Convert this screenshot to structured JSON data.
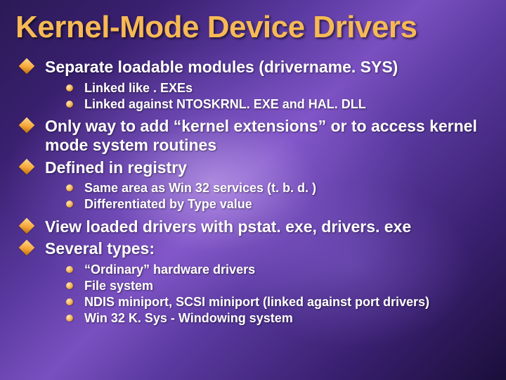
{
  "title": "Kernel-Mode Device Drivers",
  "points": [
    {
      "text": "Separate loadable modules (drivername. SYS)",
      "sub": [
        "Linked like . EXEs",
        "Linked against NTOSKRNL. EXE and HAL. DLL"
      ]
    },
    {
      "text": "Only way to add “kernel extensions” or to access kernel mode system routines",
      "sub": []
    },
    {
      "text": "Defined in registry",
      "sub": [
        "Same area as Win 32 services (t. b. d. )",
        "Differentiated by Type value"
      ]
    },
    {
      "text": "View loaded drivers with pstat. exe, drivers. exe",
      "sub": []
    },
    {
      "text": "Several types:",
      "sub": [
        "“Ordinary” hardware drivers",
        "File system",
        "NDIS miniport, SCSI miniport (linked against port drivers)",
        "Win 32 K. Sys - Windowing system"
      ]
    }
  ]
}
